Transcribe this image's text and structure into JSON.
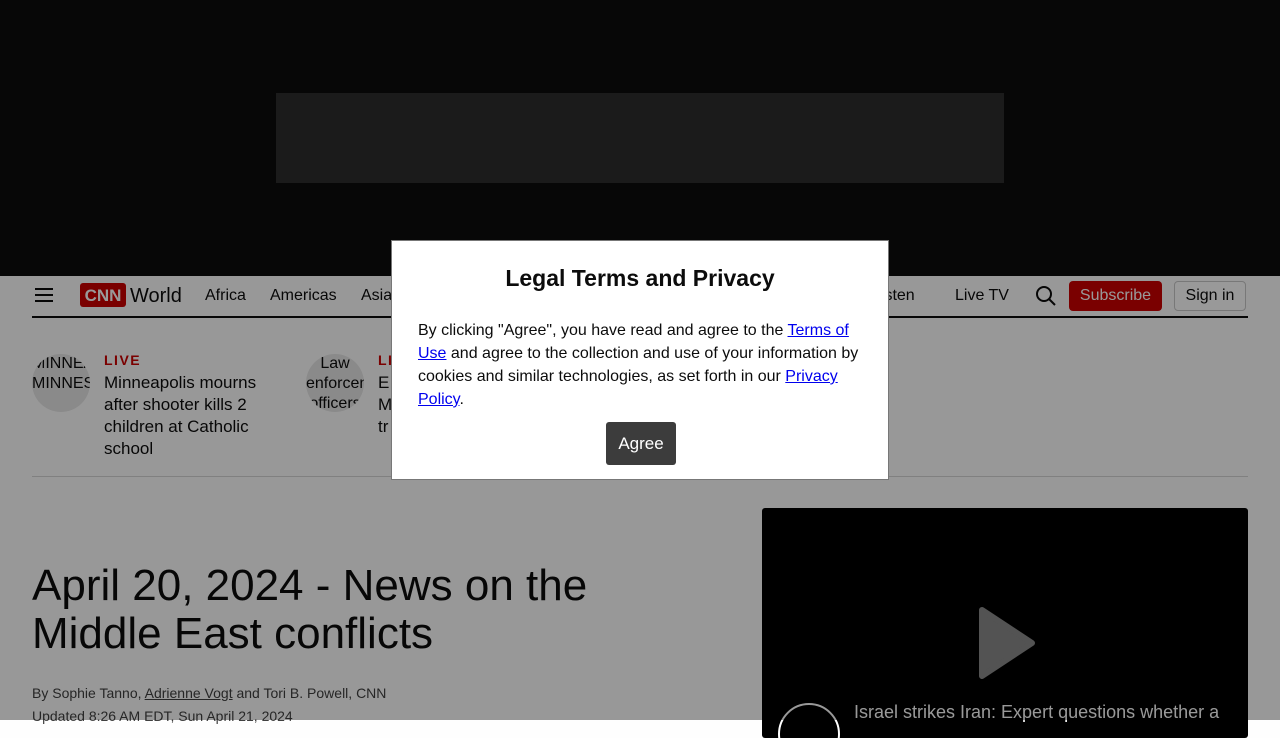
{
  "header": {
    "section_name": "World",
    "nav_links": [
      "Africa",
      "Americas",
      "Asia",
      "Listen",
      "Live TV"
    ],
    "search_icon": "search-icon",
    "subscribe_label": "Subscribe",
    "signin_label": "Sign in"
  },
  "stories": [
    {
      "badge": "LIVE",
      "thumb_alt": "MINNEAPOLIS, MINNESOTA",
      "title": "Minneapolis mourns after shooter kills 2 children at Catholic school"
    },
    {
      "badge": "LI",
      "thumb_alt": "Law enforcement officers",
      "title": "E\nM\ntr"
    }
  ],
  "article": {
    "headline": "April 20, 2024 - News on the Middle East conflicts",
    "byline_by": "By",
    "author_1": "Sophie Tanno,",
    "author_2": "Adrienne Vogt",
    "author_3": "and Tori B. Powell, CNN",
    "updated": "Updated 8:26 AM EDT, Sun April 21, 2024"
  },
  "video": {
    "caption": "Israel strikes Iran: Expert questions whether a"
  },
  "modal": {
    "title": "Legal Terms and Privacy",
    "text_1": "By clicking \"Agree\", you have read and agree to the ",
    "terms_link": "Terms of Use",
    "text_2": " and agree to the collection and use of your information by cookies and similar technologies, as set forth in our ",
    "privacy_link": "Privacy Policy",
    "text_3": ".",
    "agree_label": "Agree"
  },
  "colors": {
    "brand_red": "#cc0000",
    "ad_background": "#0c0c0c",
    "agree_button": "#3c3c3c"
  }
}
